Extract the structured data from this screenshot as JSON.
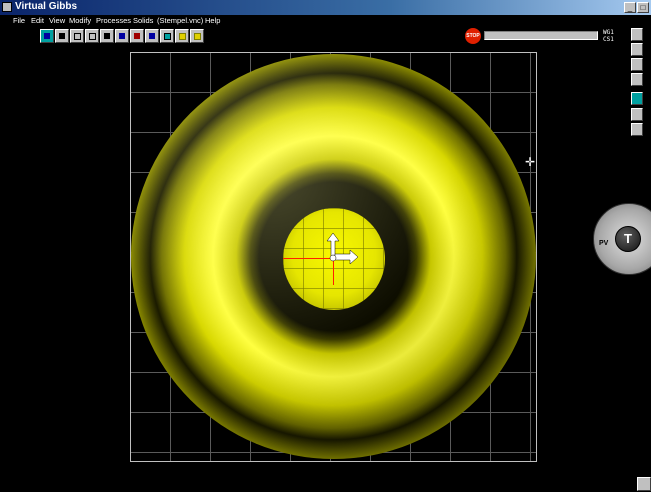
{
  "window": {
    "title": "Virtual Gibbs"
  },
  "menu": {
    "items": [
      "File",
      "Edit",
      "View",
      "Modify",
      "Processes",
      "Solids",
      "(Stempel.vnc)",
      "Help"
    ]
  },
  "toolbar": {
    "stop_label": "STOP",
    "coord1": "WG1",
    "coord2": "CS1"
  },
  "dial": {
    "center": "T",
    "left_label": "PV"
  },
  "colors": {
    "part": "#e6e600",
    "axis": "#ff2000",
    "background": "#000000",
    "grid": "#5a5a5a"
  }
}
